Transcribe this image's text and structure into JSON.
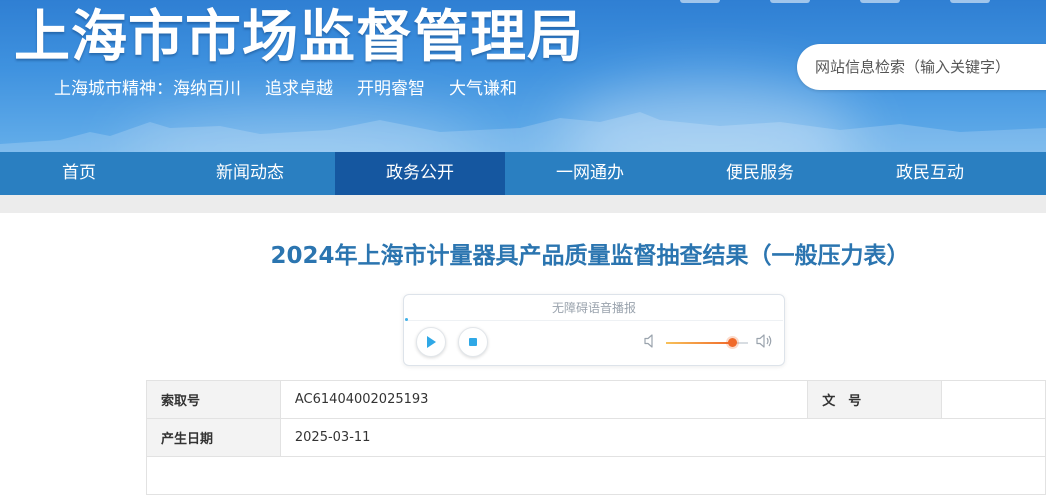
{
  "header": {
    "site_title": "上海市市场监督管理局",
    "spirit_lead": "上海城市精神：",
    "spirit_items": [
      "海纳百川",
      "追求卓越",
      "开明睿智",
      "大气谦和"
    ],
    "search_placeholder": "网站信息检索（输入关键字）"
  },
  "nav": {
    "items": [
      {
        "label": "首页",
        "active": false
      },
      {
        "label": "新闻动态",
        "active": false
      },
      {
        "label": "政务公开",
        "active": true
      },
      {
        "label": "一网通办",
        "active": false
      },
      {
        "label": "便民服务",
        "active": false
      },
      {
        "label": "政民互动",
        "active": false
      }
    ]
  },
  "article": {
    "title": "2024年上海市计量器具产品质量监督抽查结果（一般压力表）"
  },
  "player": {
    "label": "无障碍语音播报",
    "volume_level": 0.8
  },
  "info": {
    "index_no_label": "索取号",
    "index_no_value": "AC61404002025193",
    "doc_no_label": "文　号",
    "doc_no_value": "",
    "date_label": "产生日期",
    "date_value": "2025-03-11"
  },
  "colors": {
    "nav_bg": "#2a7fc1",
    "nav_active": "#1557a0",
    "title_blue": "#2b75b0",
    "volume_accent": "#f06a2a"
  }
}
